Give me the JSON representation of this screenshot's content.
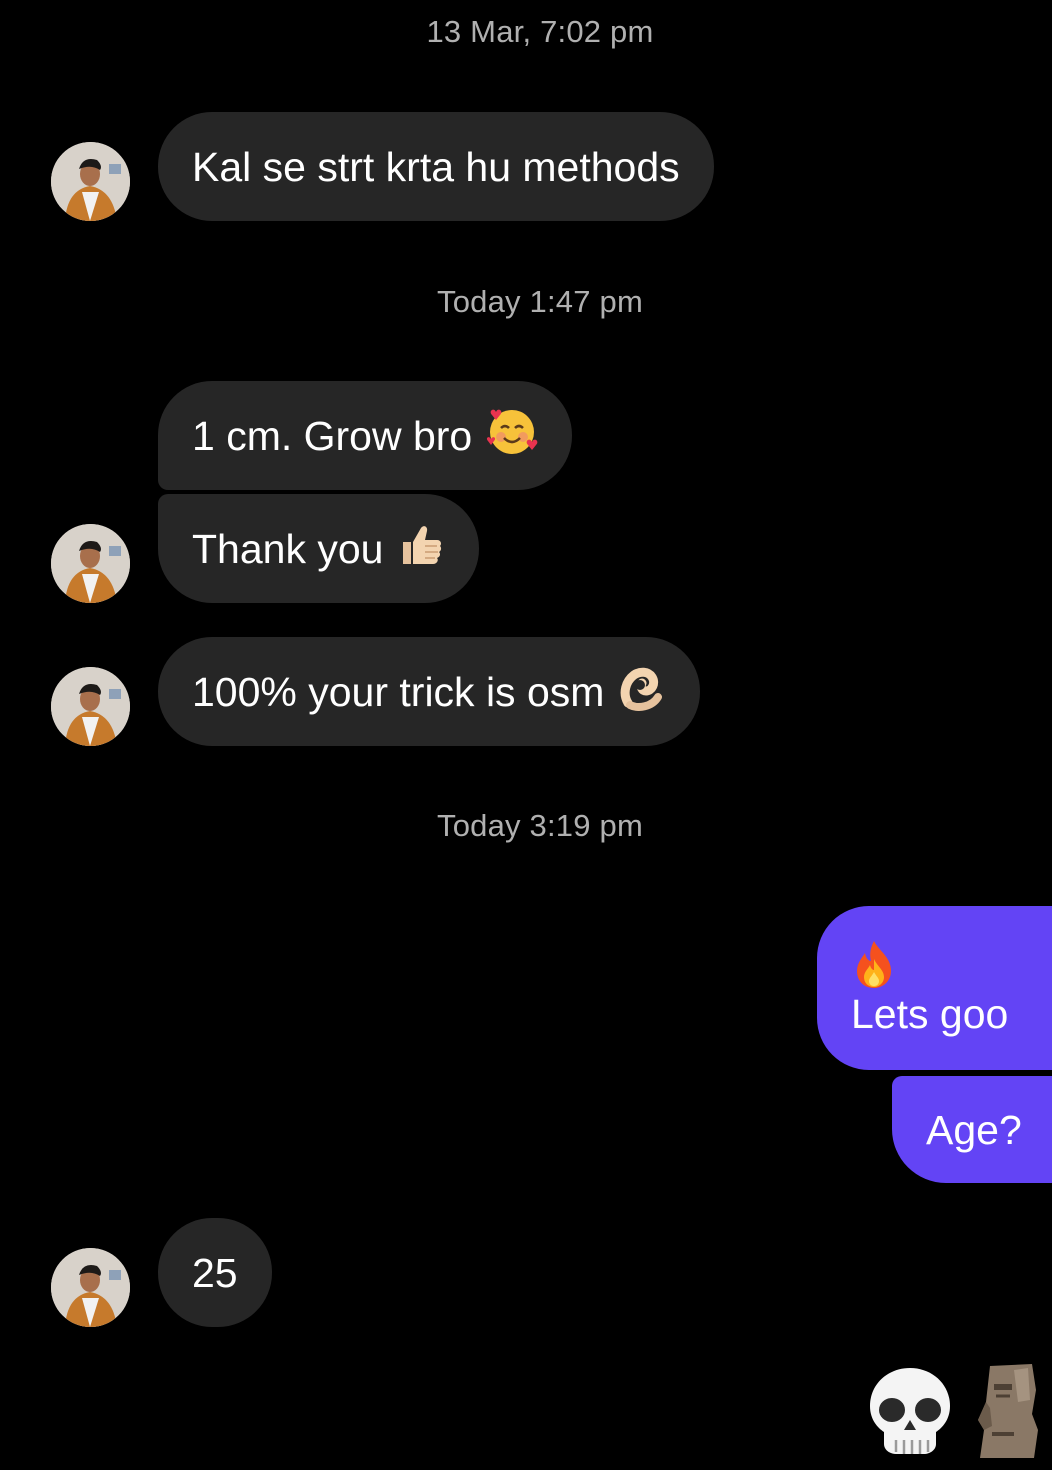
{
  "thread": {
    "timestamps": [
      "13 Mar, 7:02 pm",
      "Today 1:47 pm",
      "Today 3:19 pm"
    ],
    "messages": [
      {
        "text": "Kal se strt krta hu methods",
        "emoji_icon": ""
      },
      {
        "text": "1 cm. Grow bro",
        "emoji_icon": "smiling-face-with-hearts-icon"
      },
      {
        "text": "Thank you",
        "emoji_icon": "thumbs-up-icon"
      },
      {
        "text": "100% your trick is osm",
        "emoji_icon": "ok-hand-icon"
      },
      {
        "text": "Lets goo",
        "emoji_icon": "fire-icon"
      },
      {
        "text": "Age?",
        "emoji_icon": ""
      },
      {
        "text": "25",
        "emoji_icon": ""
      }
    ],
    "trailing_emojis": [
      "skull-icon",
      "moai-icon"
    ]
  },
  "colors": {
    "background": "#000000",
    "received_bubble": "#262626",
    "sent_bubble": "#6344f5",
    "timestamp_text": "#b0b0b0"
  }
}
